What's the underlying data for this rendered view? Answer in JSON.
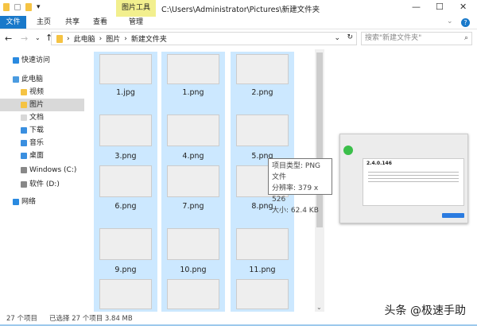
{
  "window": {
    "title": "C:\\Users\\Administrator\\Pictures\\新建文件夹",
    "context_tab": "图片工具"
  },
  "ribbon": {
    "tabs": [
      "文件",
      "主页",
      "共享",
      "查看",
      "管理"
    ]
  },
  "address": {
    "crumbs": [
      "此电脑",
      "图片",
      "新建文件夹"
    ],
    "search_placeholder": "搜索\"新建文件夹\""
  },
  "nav": [
    {
      "label": "快速访问",
      "icon": "star-icon",
      "color": "#2a8ae0"
    },
    {
      "label": "此电脑",
      "icon": "computer-icon",
      "color": "#4a9be0"
    },
    {
      "label": "视频",
      "icon": "video-folder-icon",
      "color": "#f5c343"
    },
    {
      "label": "图片",
      "icon": "pictures-folder-icon",
      "color": "#f5c343",
      "selected": true
    },
    {
      "label": "文档",
      "icon": "documents-folder-icon",
      "color": "#d8d8d8"
    },
    {
      "label": "下载",
      "icon": "downloads-folder-icon",
      "color": "#3a8fe0"
    },
    {
      "label": "音乐",
      "icon": "music-folder-icon",
      "color": "#3a8fe0"
    },
    {
      "label": "桌面",
      "icon": "desktop-folder-icon",
      "color": "#3a8fe0"
    },
    {
      "label": "Windows (C:)",
      "icon": "drive-icon",
      "color": "#888"
    },
    {
      "label": "软件 (D:)",
      "icon": "drive-icon",
      "color": "#888"
    },
    {
      "label": "网络",
      "icon": "network-icon",
      "color": "#2a8ae0"
    }
  ],
  "files": [
    "1.jpg",
    "1.png",
    "2.png",
    "3.png",
    "4.png",
    "5.png",
    "6.png",
    "7.png",
    "8.png",
    "9.png",
    "10.png",
    "11.png",
    "",
    "",
    ""
  ],
  "tooltip": {
    "type": "项目类型: PNG 文件",
    "resolution": "分辨率: 379 x 526",
    "size": "大小: 62.4 KB"
  },
  "preview": {
    "version": "2.4.0.146"
  },
  "status": {
    "count": "27 个项目",
    "selected": "已选择 27 个项目  3.84 MB"
  },
  "watermark": "头条 @极速手助"
}
